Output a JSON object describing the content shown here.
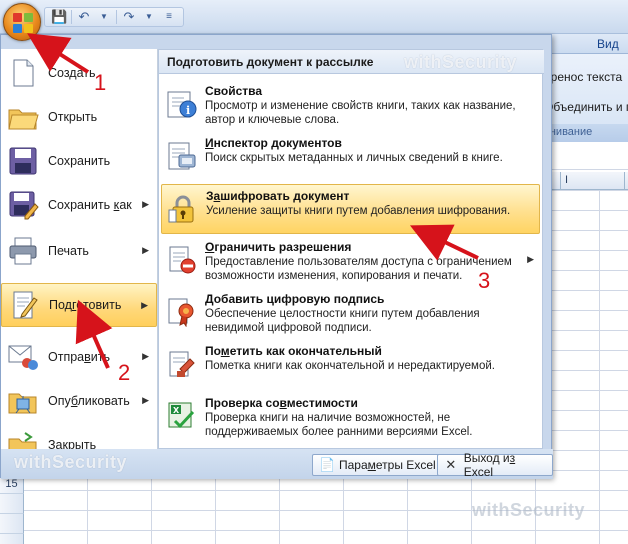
{
  "ribbon": {
    "tabs": [
      "Вид"
    ],
    "commands": [
      "еренос текста",
      "Объединить и п"
    ],
    "group_label": "внивание",
    "column_header_letter": "I"
  },
  "grid": {
    "visible_row_number": "15"
  },
  "office_menu": {
    "left_items": [
      {
        "label": "Создать",
        "icon": "new-document-icon",
        "has_submenu": false
      },
      {
        "label": "Открыть",
        "icon": "open-folder-icon",
        "has_submenu": false
      },
      {
        "label": "Сохранить",
        "icon": "save-disk-icon",
        "has_submenu": false
      },
      {
        "label": "Сохранить как",
        "icon": "save-as-icon",
        "has_submenu": true
      },
      {
        "label": "Печать",
        "icon": "printer-icon",
        "has_submenu": true
      },
      {
        "label": "Подготовить",
        "icon": "prepare-document-icon",
        "has_submenu": true,
        "selected": true
      },
      {
        "label": "Отправить",
        "icon": "send-icon",
        "has_submenu": true
      },
      {
        "label": "Опубликовать",
        "icon": "publish-icon",
        "has_submenu": true
      },
      {
        "label": "Закрыть",
        "icon": "close-folder-icon",
        "has_submenu": false
      }
    ],
    "submenu_title": "Подготовить документ к рассылке",
    "submenu_items": [
      {
        "title": "Свойства",
        "desc": "Просмотр и изменение свойств книги, таких как название, автор и ключевые слова.",
        "icon": "properties-icon"
      },
      {
        "title": "Инспектор документов",
        "desc": "Поиск скрытых метаданных и личных сведений в книге.",
        "icon": "inspect-document-icon"
      },
      {
        "title": "Зашифровать документ",
        "desc": "Усиление защиты книги путем добавления шифрования.",
        "icon": "padlock-icon",
        "selected": true
      },
      {
        "title": "Ограничить разрешения",
        "desc": "Предоставление пользователям доступа с ограничением возможности изменения, копирования и печати.",
        "icon": "restrict-permission-icon",
        "has_submenu": true
      },
      {
        "title": "Добавить цифровую подпись",
        "desc": "Обеспечение целостности книги путем добавления невидимой цифровой подписи.",
        "icon": "digital-signature-icon"
      },
      {
        "title": "Пометить как окончательный",
        "desc": "Пометка книги как окончательной и нередактируемой.",
        "icon": "mark-final-icon"
      },
      {
        "title": "Проверка совместимости",
        "desc": "Проверка книги на наличие возможностей, не поддерживаемых более ранними версиями Excel.",
        "icon": "compatibility-check-icon"
      }
    ],
    "footer": {
      "options_label": "Параметры Excel",
      "exit_label": "Выход из Excel"
    }
  },
  "annotations": {
    "step1": "1",
    "step2": "2",
    "step3": "3",
    "color": "#d6131b"
  },
  "watermark": "withSecurity"
}
